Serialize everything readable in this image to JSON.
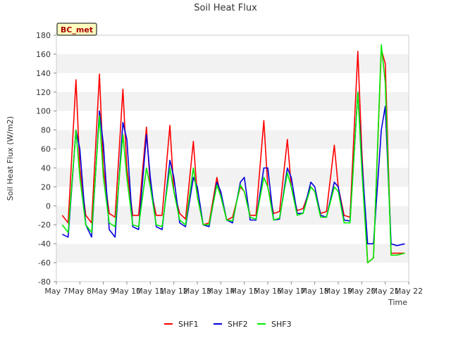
{
  "chart_data": {
    "type": "line",
    "title": "Soil Heat Flux",
    "xlabel": "Time",
    "ylabel": "Soil Heat Flux (W/m2)",
    "ylim": [
      -80,
      180
    ],
    "yticks": [
      -80,
      -60,
      -40,
      -20,
      0,
      20,
      40,
      60,
      80,
      100,
      120,
      140,
      160,
      180
    ],
    "xlim": [
      "May 7",
      "May 22"
    ],
    "xticks": [
      "May 7",
      "May 8",
      "May 9",
      "May 10",
      "May 11",
      "May 12",
      "May 13",
      "May 14",
      "May 15",
      "May 16",
      "May 17",
      "May 18",
      "May 19",
      "May 20",
      "May 21",
      "May 22"
    ],
    "grid": "horizontal bands",
    "legend_position": "bottom-center",
    "badge": "BC_met",
    "series": [
      {
        "name": "SHF1",
        "color": "#ff0000",
        "x": [
          "May 7 06:00",
          "May 7 12:00",
          "May 7 20:00",
          "May 8 00:00",
          "May 8 06:00",
          "May 8 12:00",
          "May 8 20:00",
          "May 9 00:00",
          "May 9 06:00",
          "May 9 12:00",
          "May 9 20:00",
          "May 10 00:00",
          "May 10 06:00",
          "May 10 12:00",
          "May 10 20:00",
          "May 11 00:00",
          "May 11 06:00",
          "May 11 12:00",
          "May 11 20:00",
          "May 12 00:00",
          "May 12 06:00",
          "May 12 12:00",
          "May 12 20:00",
          "May 13 00:00",
          "May 13 06:00",
          "May 13 12:00",
          "May 13 20:00",
          "May 14 00:00",
          "May 14 06:00",
          "May 14 12:00",
          "May 14 20:00",
          "May 15 00:00",
          "May 15 06:00",
          "May 15 12:00",
          "May 15 20:00",
          "May 16 00:00",
          "May 16 06:00",
          "May 16 12:00",
          "May 16 20:00",
          "May 17 00:00",
          "May 17 06:00",
          "May 17 12:00",
          "May 17 20:00",
          "May 18 00:00",
          "May 18 06:00",
          "May 18 12:00",
          "May 18 20:00",
          "May 19 00:00",
          "May 19 06:00",
          "May 19 12:00",
          "May 19 20:00",
          "May 20 00:00",
          "May 20 06:00",
          "May 20 12:00",
          "May 20 20:00",
          "May 21 00:00",
          "May 21 06:00",
          "May 21 12:00",
          "May 21 20:00"
        ],
        "y": [
          -10,
          -18,
          133,
          40,
          -10,
          -18,
          139,
          40,
          -8,
          -12,
          123,
          40,
          -10,
          -10,
          83,
          20,
          -10,
          -10,
          85,
          15,
          -8,
          -14,
          68,
          10,
          -20,
          -18,
          30,
          10,
          -15,
          -12,
          20,
          15,
          -10,
          -10,
          90,
          20,
          -8,
          -6,
          70,
          20,
          -5,
          -3,
          20,
          15,
          -8,
          -6,
          64,
          20,
          -10,
          -12,
          163,
          60,
          -60,
          -55,
          165,
          150,
          -50,
          -50,
          -50
        ]
      },
      {
        "name": "SHF2",
        "color": "#0000dd",
        "x": [
          "May 7 06:00",
          "May 7 12:00",
          "May 7 20:00",
          "May 8 00:00",
          "May 8 06:00",
          "May 8 12:00",
          "May 8 20:00",
          "May 9 00:00",
          "May 9 06:00",
          "May 9 12:00",
          "May 9 20:00",
          "May 10 00:00",
          "May 10 06:00",
          "May 10 12:00",
          "May 10 20:00",
          "May 11 00:00",
          "May 11 06:00",
          "May 11 12:00",
          "May 11 20:00",
          "May 12 00:00",
          "May 12 06:00",
          "May 12 12:00",
          "May 12 20:00",
          "May 13 00:00",
          "May 13 06:00",
          "May 13 12:00",
          "May 13 20:00",
          "May 14 00:00",
          "May 14 06:00",
          "May 14 12:00",
          "May 14 20:00",
          "May 15 00:00",
          "May 15 06:00",
          "May 15 12:00",
          "May 15 20:00",
          "May 16 00:00",
          "May 16 06:00",
          "May 16 12:00",
          "May 16 20:00",
          "May 17 00:00",
          "May 17 06:00",
          "May 17 12:00",
          "May 17 20:00",
          "May 18 00:00",
          "May 18 06:00",
          "May 18 12:00",
          "May 18 20:00",
          "May 19 00:00",
          "May 19 06:00",
          "May 19 12:00",
          "May 19 20:00",
          "May 20 00:00",
          "May 20 06:00",
          "May 20 12:00",
          "May 20 20:00",
          "May 21 00:00",
          "May 21 06:00",
          "May 21 12:00",
          "May 21 20:00"
        ],
        "y": [
          -30,
          -33,
          80,
          60,
          -20,
          -33,
          100,
          65,
          -25,
          -33,
          88,
          70,
          -22,
          -25,
          75,
          30,
          -22,
          -25,
          48,
          30,
          -18,
          -22,
          30,
          20,
          -20,
          -22,
          25,
          15,
          -15,
          -18,
          25,
          30,
          -15,
          -15,
          40,
          40,
          -15,
          -14,
          40,
          30,
          -8,
          -8,
          25,
          20,
          -10,
          -12,
          25,
          20,
          -15,
          -16,
          120,
          50,
          -40,
          -40,
          80,
          105,
          -40,
          -42,
          -40
        ]
      },
      {
        "name": "SHF3",
        "color": "#00ee00",
        "x": [
          "May 7 06:00",
          "May 7 12:00",
          "May 7 20:00",
          "May 8 00:00",
          "May 8 06:00",
          "May 8 12:00",
          "May 8 20:00",
          "May 9 00:00",
          "May 9 06:00",
          "May 9 12:00",
          "May 9 20:00",
          "May 10 00:00",
          "May 10 06:00",
          "May 10 12:00",
          "May 10 20:00",
          "May 11 00:00",
          "May 11 06:00",
          "May 11 12:00",
          "May 11 20:00",
          "May 12 00:00",
          "May 12 06:00",
          "May 12 12:00",
          "May 12 20:00",
          "May 13 00:00",
          "May 13 06:00",
          "May 13 12:00",
          "May 13 20:00",
          "May 14 00:00",
          "May 14 06:00",
          "May 14 12:00",
          "May 14 20:00",
          "May 15 00:00",
          "May 15 06:00",
          "May 15 12:00",
          "May 15 20:00",
          "May 16 00:00",
          "May 16 06:00",
          "May 16 12:00",
          "May 16 20:00",
          "May 17 00:00",
          "May 17 06:00",
          "May 17 12:00",
          "May 17 20:00",
          "May 18 00:00",
          "May 18 06:00",
          "May 18 12:00",
          "May 18 20:00",
          "May 19 00:00",
          "May 19 06:00",
          "May 19 12:00",
          "May 19 20:00",
          "May 20 00:00",
          "May 20 06:00",
          "May 20 12:00",
          "May 20 20:00",
          "May 21 00:00",
          "May 21 06:00",
          "May 21 12:00",
          "May 21 20:00"
        ],
        "y": [
          -20,
          -28,
          80,
          30,
          -20,
          -28,
          95,
          30,
          -18,
          -22,
          75,
          30,
          -20,
          -22,
          40,
          20,
          -20,
          -22,
          40,
          15,
          -15,
          -20,
          40,
          10,
          -20,
          -20,
          22,
          10,
          -15,
          -16,
          22,
          15,
          -12,
          -14,
          30,
          20,
          -15,
          -13,
          35,
          20,
          -10,
          -8,
          20,
          15,
          -12,
          -12,
          20,
          15,
          -18,
          -18,
          120,
          40,
          -60,
          -55,
          170,
          130,
          -52,
          -52,
          -50
        ]
      }
    ]
  }
}
